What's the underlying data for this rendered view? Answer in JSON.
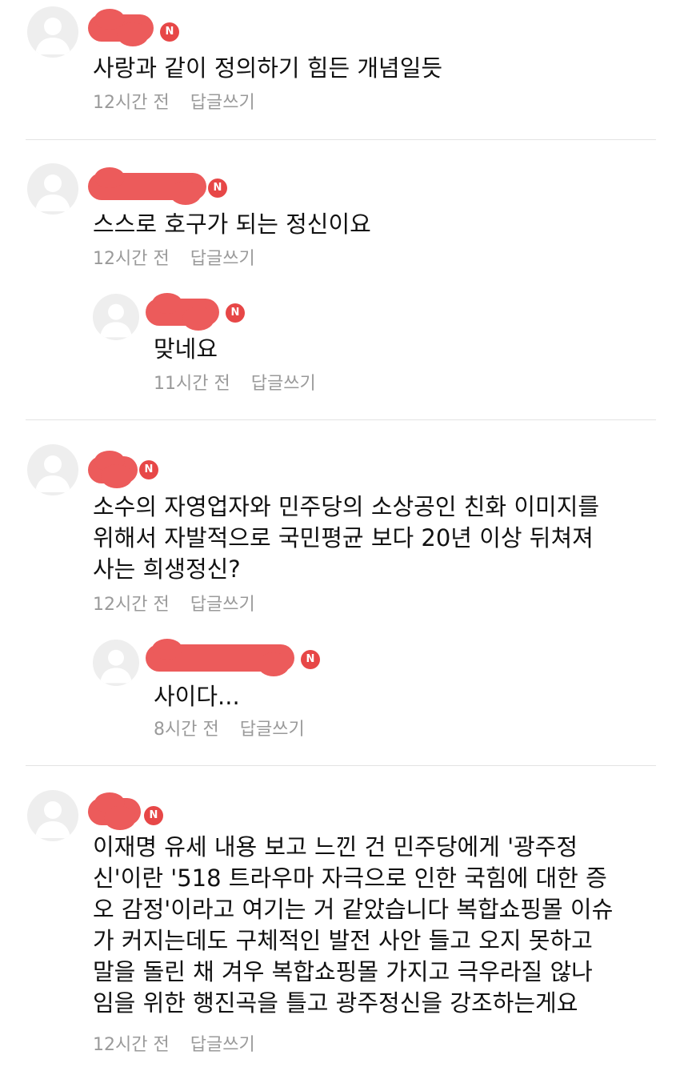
{
  "new_badge": "N",
  "reply_link": "답글쓰기",
  "comments": [
    {
      "text": "사랑과 같이 정의하기 힘든 개념일듯",
      "time": "12시간 전"
    },
    {
      "text": "스스로 호구가 되는 정신이요",
      "time": "12시간 전",
      "replies": [
        {
          "text": "맞네요",
          "time": "11시간 전"
        }
      ]
    },
    {
      "text": "소수의 자영업자와 민주당의 소상공인 친화 이미지를\n위해서 자발적으로 국민평균 보다 20년 이상 뒤쳐져\n사는 희생정신?",
      "time": "12시간 전",
      "replies": [
        {
          "text": "사이다...",
          "time": "8시간 전"
        }
      ]
    },
    {
      "text": "이재명 유세 내용 보고 느낀 건 민주당에게 '광주정\n신'이란 '518 트라우마 자극으로 인한 국힘에 대한 증\n오 감정'이라고 여기는 거 같았습니다 복합쇼핑몰 이슈\n가 커지는데도 구체적인 발전 사안 들고 오지 못하고\n말을 돌린 채 겨우 복합쇼핑몰 가지고 극우라질 않나\n임을 위한 행진곡을 틀고 광주정신을 강조하는게요",
      "time": "12시간 전"
    }
  ]
}
